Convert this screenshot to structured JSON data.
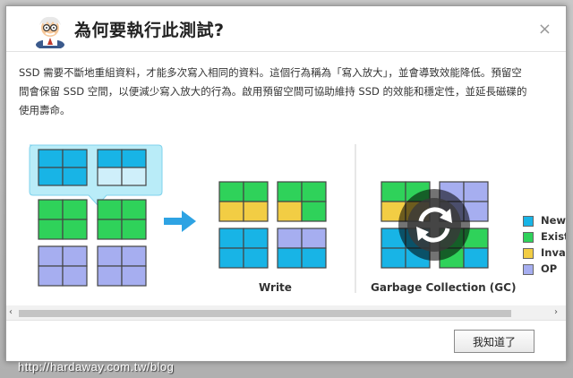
{
  "dialog": {
    "title": "為何要執行此測試?",
    "close_glyph": "×",
    "description": "SSD 需要不斷地重組資料，才能多次寫入相同的資料。這個行為稱為「寫入放大」，並會導致效能降低。預留空間會保留 SSD 空間，以便減少寫入放大的行為。啟用預留空間可協助維持 SSD 的效能和穩定性，並延長磁碟的使用壽命。",
    "ok_label": "我知道了"
  },
  "diagram": {
    "write_caption": "Write",
    "gc_caption": "Garbage Collection (GC)",
    "colors": {
      "new": "#18b4e6",
      "existing": "#2fd25a",
      "invalid": "#f2cd44",
      "op": "#a6aef0",
      "popup": "#b9ecf8",
      "light": "#cfeffa",
      "arrow": "#2ea3e3"
    },
    "legend": [
      {
        "label": "New",
        "color": "#18b4e6"
      },
      {
        "label": "Exist",
        "color": "#2fd25a"
      },
      {
        "label": "Invai",
        "color": "#f2cd44"
      },
      {
        "label": "OP",
        "color": "#a6aef0"
      }
    ]
  },
  "scrollbar": {
    "left_arrow": "‹",
    "right_arrow": "›"
  },
  "watermark": "http://hardaway.com.tw/blog"
}
